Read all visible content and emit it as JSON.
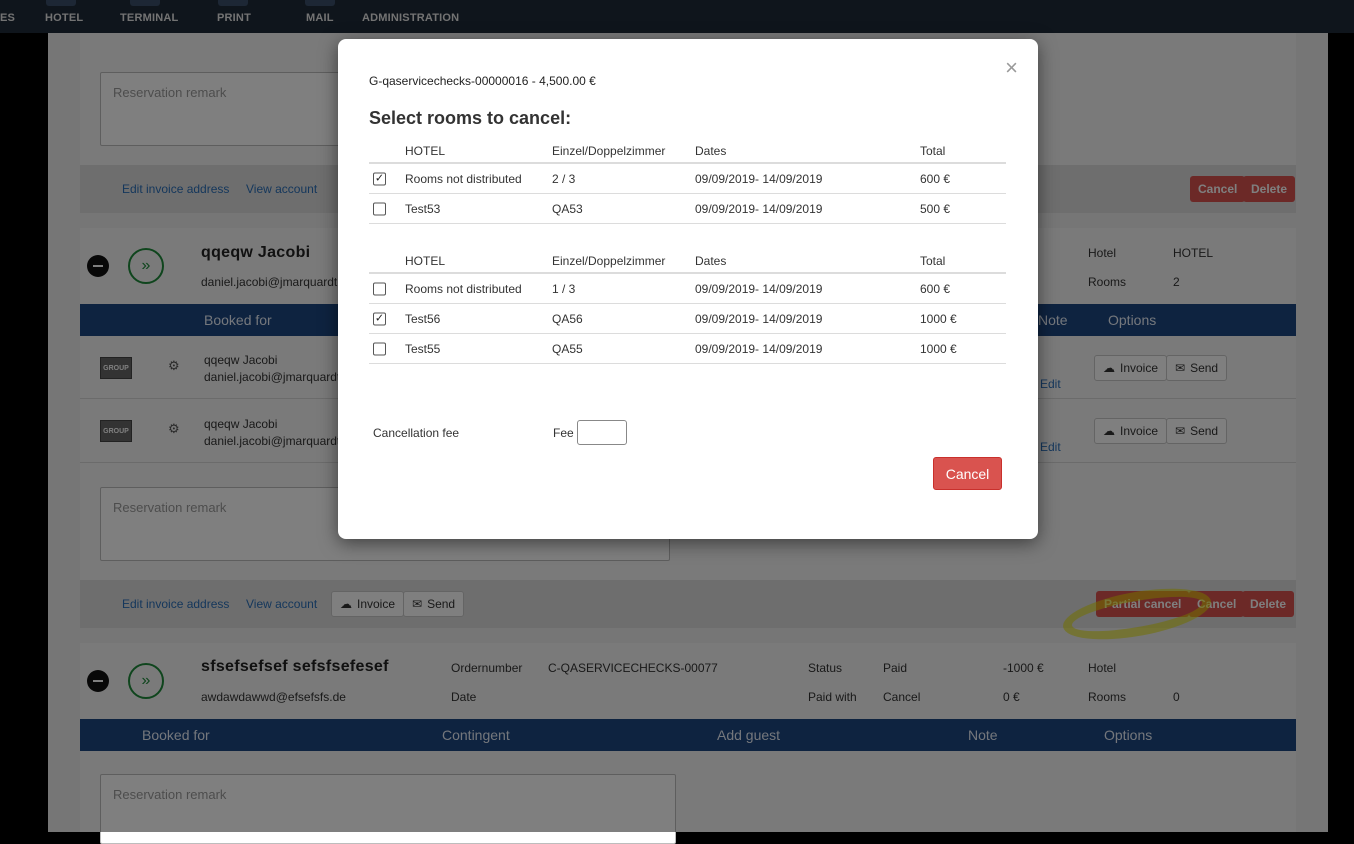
{
  "nav": {
    "items": [
      "ES",
      "HOTEL",
      "TERMINAL",
      "PRINT",
      "MAIL",
      "ADMINISTRATION"
    ]
  },
  "background": {
    "remark_placeholder": "Reservation remark",
    "links": {
      "edit_invoice": "Edit invoice address",
      "view_account": "View account"
    },
    "buttons": {
      "invoice": "Invoice",
      "send": "Send",
      "partial_cancel": "Partial cancel",
      "cancel": "Cancel",
      "delete": "Delete"
    },
    "booking2": {
      "name": "qqeqw  Jacobi",
      "email": "daniel.jacobi@jmarquardt",
      "hotel_label": "Hotel",
      "hotel_value": "HOTEL",
      "rooms_label": "Rooms",
      "rooms_value": "2",
      "table_headers": {
        "booked_for": "Booked for",
        "note": "Note",
        "options": "Options"
      },
      "rows": [
        {
          "badge": "GROUP",
          "name": "qqeqw Jacobi",
          "email": "daniel.jacobi@jmarquardt",
          "edit": "Edit"
        },
        {
          "badge": "GROUP",
          "name": "qqeqw Jacobi",
          "email": "daniel.jacobi@jmarquardt",
          "edit": "Edit"
        }
      ]
    },
    "booking3": {
      "name": "sfsefsefsef  sefsfsefesef",
      "email": "awdawdawwd@efsefsfs.de",
      "ordernumber_label": "Ordernumber",
      "ordernumber_value": "C-QASERVICECHECKS-00077",
      "date_label": "Date",
      "status_label": "Status",
      "status_value": "Paid",
      "paid_with_label": "Paid with",
      "paid_with_value": "Cancel",
      "amount1": "-1000 €",
      "amount2": "0 €",
      "hotel_label": "Hotel",
      "rooms_label": "Rooms",
      "rooms_value": "0",
      "table_headers": {
        "booked_for": "Booked for",
        "contingent": "Contingent",
        "add_guest": "Add guest",
        "note": "Note",
        "options": "Options"
      }
    },
    "colors": {
      "header_blue": "#1c4680",
      "danger_red": "#d9534f",
      "success_green": "#1e8a3a"
    }
  },
  "modal": {
    "reference": "G-qaservicechecks-00000016 - 4,500.00 €",
    "title": "Select rooms to cancel:",
    "close_symbol": "×",
    "headers": {
      "hotel": "HOTEL",
      "room_type": "Einzel/Doppelzimmer",
      "dates": "Dates",
      "total": "Total"
    },
    "tables": [
      {
        "rows": [
          {
            "checked": true,
            "hotel": "Rooms not distributed",
            "rooms": "2 / 3",
            "dates": "09/09/2019- 14/09/2019",
            "total": "600 €"
          },
          {
            "checked": false,
            "hotel": "Test53",
            "rooms": "QA53",
            "dates": "09/09/2019- 14/09/2019",
            "total": "500 €"
          }
        ]
      },
      {
        "rows": [
          {
            "checked": false,
            "hotel": "Rooms not distributed",
            "rooms": "1 / 3",
            "dates": "09/09/2019- 14/09/2019",
            "total": "600 €"
          },
          {
            "checked": true,
            "hotel": "Test56",
            "rooms": "QA56",
            "dates": "09/09/2019- 14/09/2019",
            "total": "1000 €"
          },
          {
            "checked": false,
            "hotel": "Test55",
            "rooms": "QA55",
            "dates": "09/09/2019- 14/09/2019",
            "total": "1000 €"
          }
        ]
      }
    ],
    "fee": {
      "label": "Cancellation fee",
      "prefix": "Fee",
      "value": ""
    },
    "cancel_label": "Cancel"
  }
}
